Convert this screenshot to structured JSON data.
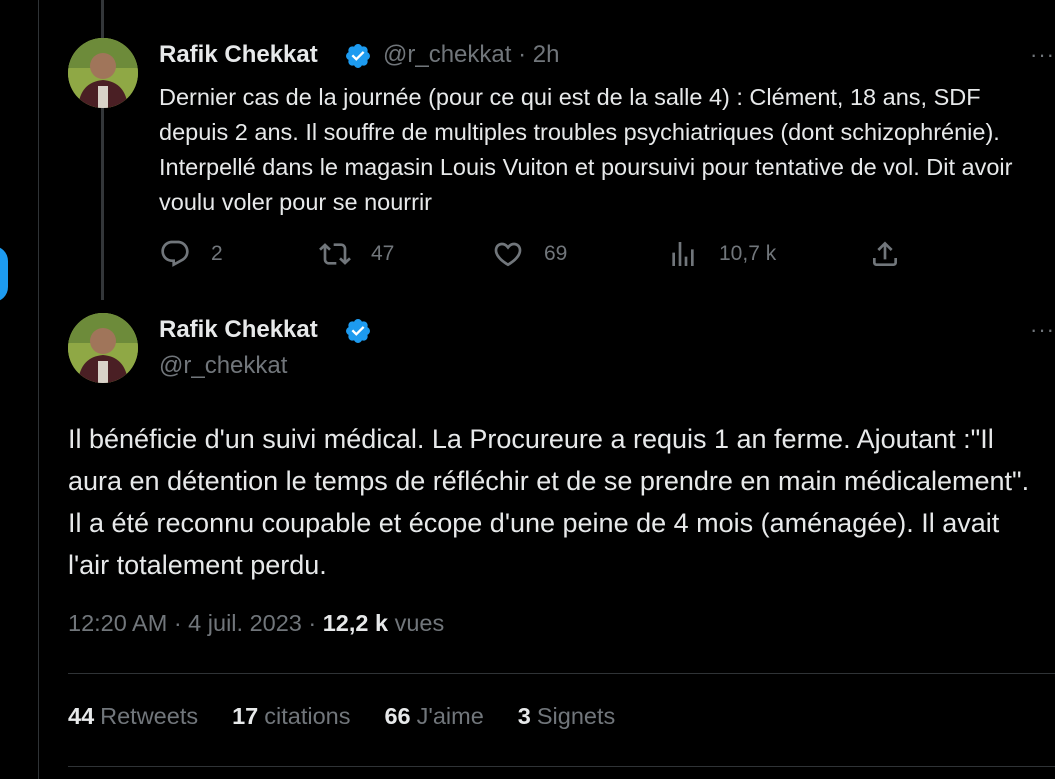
{
  "tweet1": {
    "name": "Rafik Chekkat",
    "handle_time": "@r_chekkat · 2h",
    "more": "···",
    "text": "Dernier cas de la journée (pour ce qui est de la salle 4) : Clément, 18 ans, SDF depuis 2 ans. Il souffre de multiples troubles psychiatriques (dont schizophrénie). Interpellé dans le magasin Louis Vuiton et poursuivi pour tentative de vol. Dit avoir voulu voler pour se nourrir",
    "actions": {
      "replies": "2",
      "retweets": "47",
      "likes": "69",
      "views": "10,7 k"
    }
  },
  "tweet2": {
    "name": "Rafik Chekkat",
    "handle": "@r_chekkat",
    "more": "···",
    "text": "Il bénéficie d'un suivi médical. La Procureure a requis 1 an ferme. Ajoutant :\"Il aura en détention le temps de réfléchir et de se prendre en main médicalement\". Il a été reconnu coupable et écope d'une peine de 4 mois (aménagée). Il avait l'air totalement perdu.",
    "time": "12:20 AM · 4 juil. 2023 · ",
    "views_count": "12,2 k",
    "views_label": " vues",
    "stats": {
      "retweets_count": "44",
      "retweets_label": "Retweets",
      "quotes_count": "17",
      "quotes_label": "citations",
      "likes_count": "66",
      "likes_label": "J'aime",
      "bookmarks_count": "3",
      "bookmarks_label": "Signets"
    }
  },
  "colors": {
    "background": "#000000",
    "text": "#e7e9ea",
    "muted": "#71767b",
    "accent": "#1d9bf0",
    "border": "#2f3336"
  }
}
